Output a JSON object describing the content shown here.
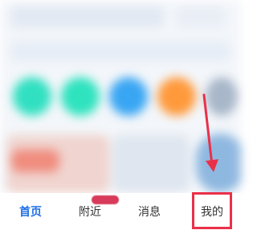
{
  "tabbar": {
    "home_label": "首页",
    "nearby_label": "附近",
    "messages_label": "消息",
    "mine_label": "我的"
  },
  "colors": {
    "active_tab": "#1f6fe4",
    "highlight": "#ea3049",
    "badge": "#d83a5a"
  }
}
